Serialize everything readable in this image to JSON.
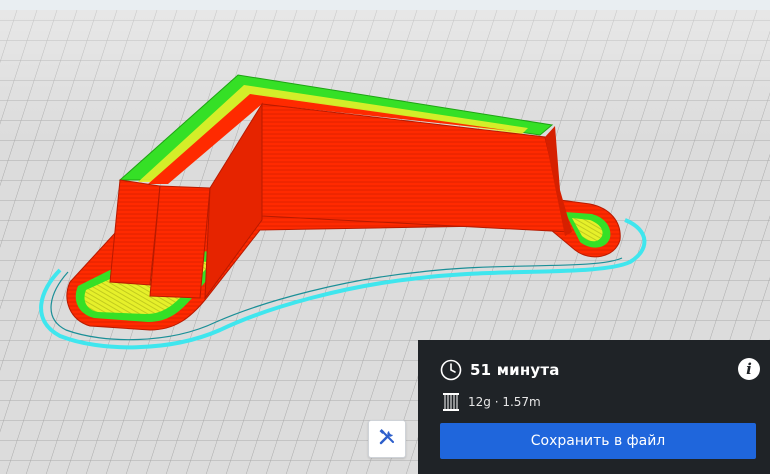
{
  "print_panel": {
    "time": "51 минута",
    "material": "12g · 1.57m",
    "save_label": "Сохранить в файл"
  },
  "toolbar": {
    "tool_icon": "wrench-screwdriver-icon"
  },
  "colors": {
    "wall": "#ff2a00",
    "infill": "#e6f02a",
    "inner_wall": "#35e026",
    "skirt": "#3fe6ee",
    "panel_bg": "#1f2327",
    "accent": "#1f66dc"
  }
}
